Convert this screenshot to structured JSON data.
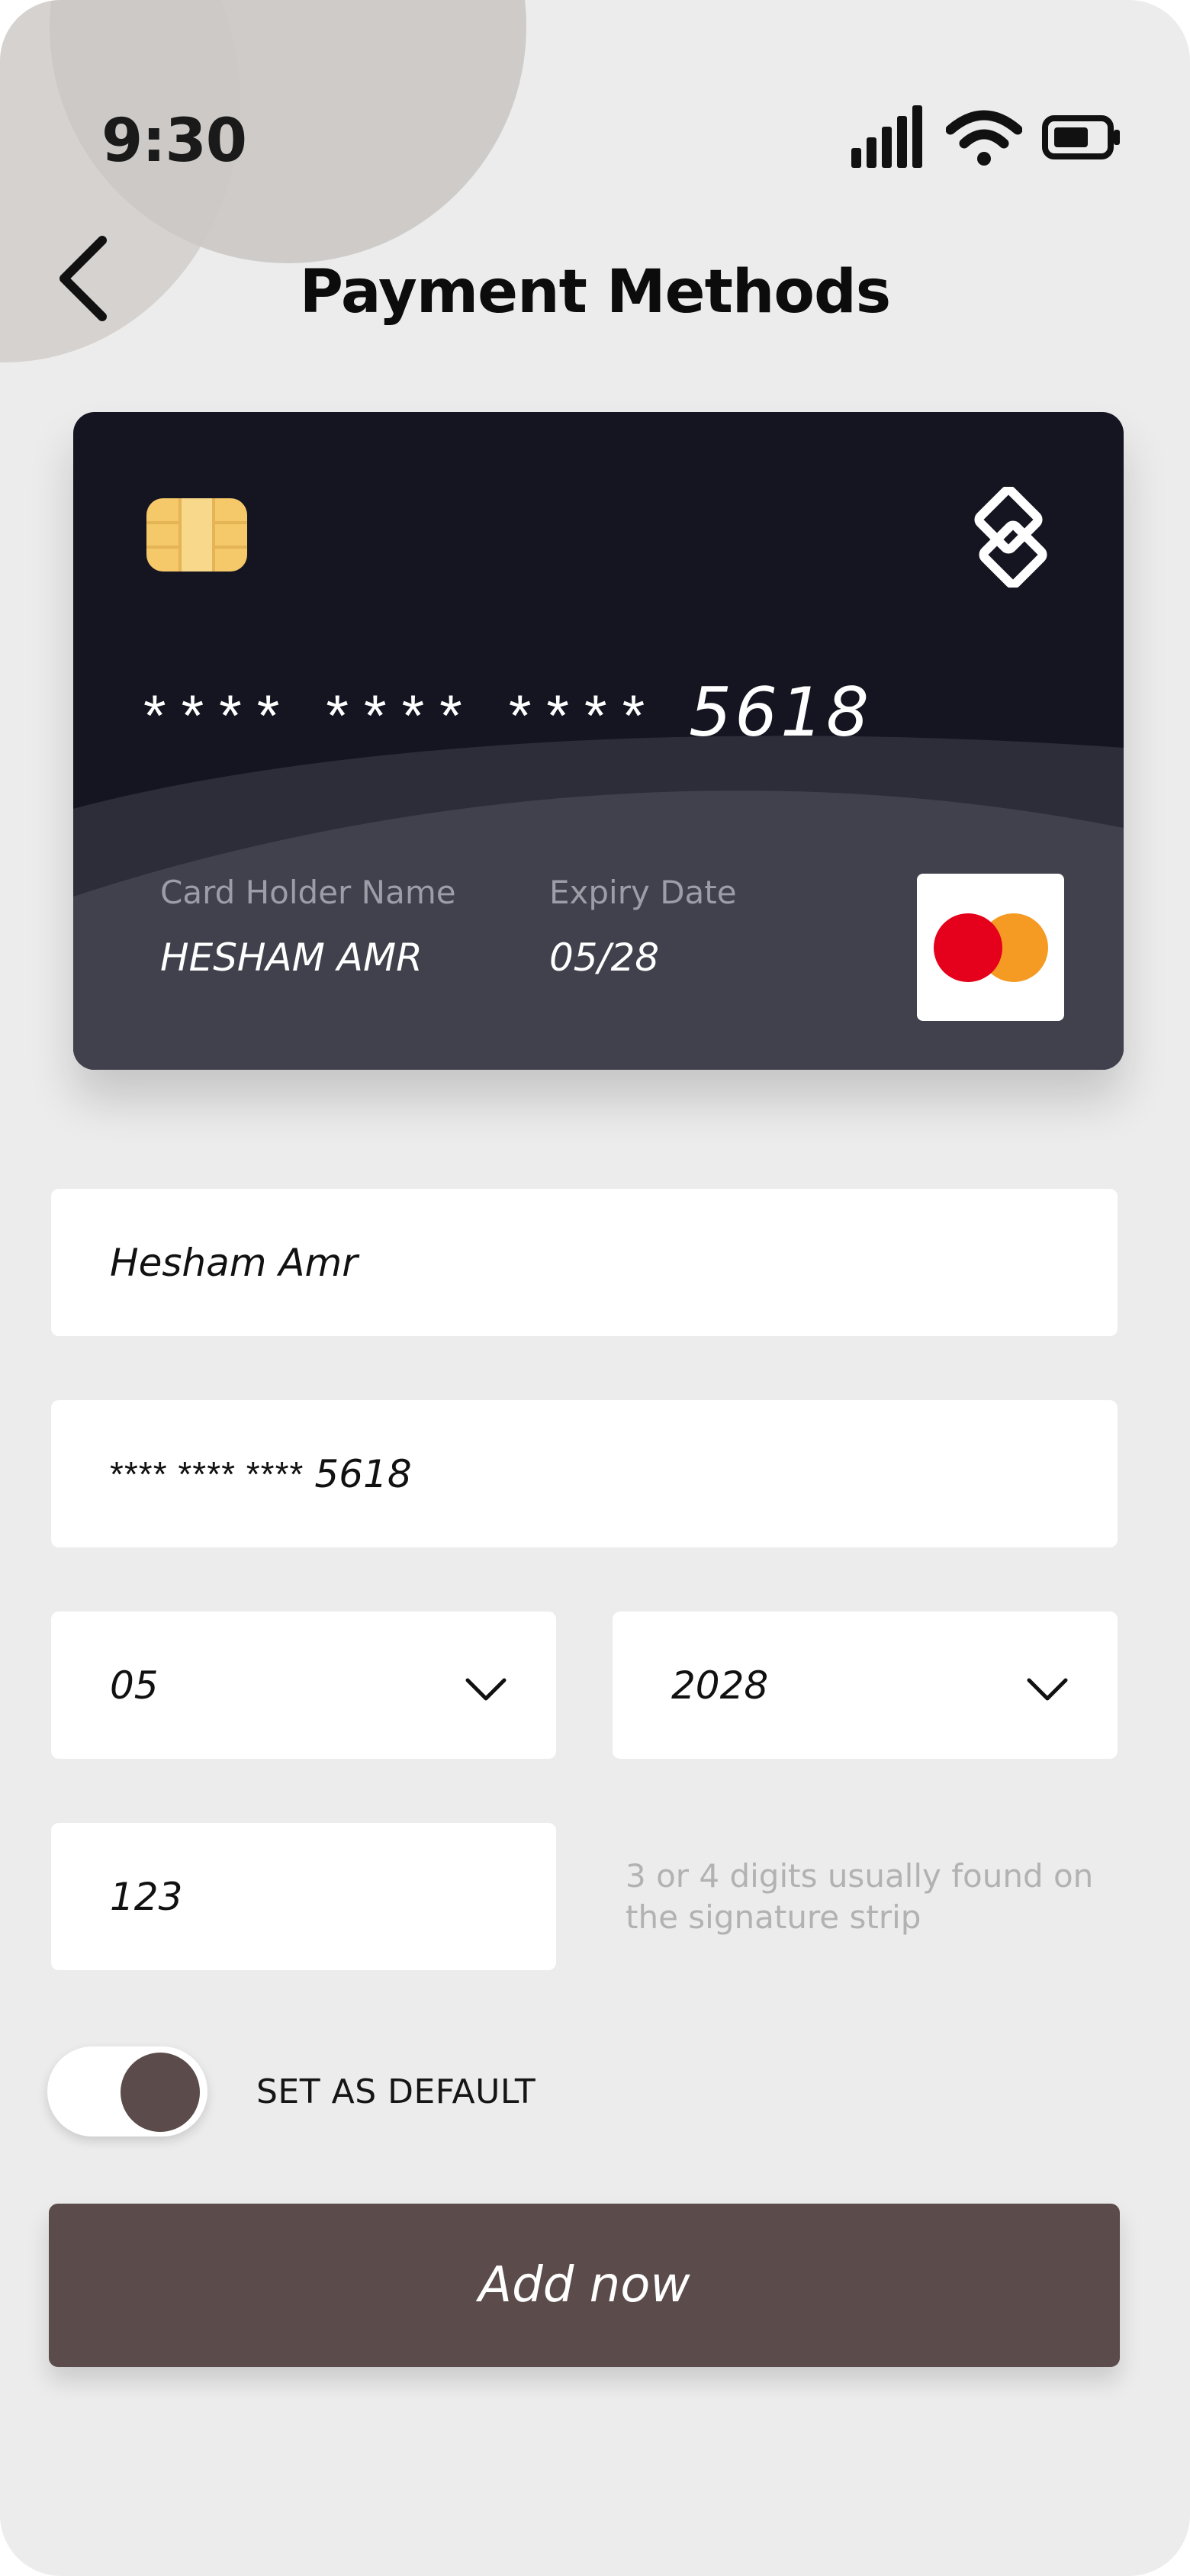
{
  "status_bar": {
    "time": "9:30",
    "icons": [
      "signal-icon",
      "wifi-icon",
      "battery-icon"
    ]
  },
  "header": {
    "title": "Payment Methods",
    "back_icon": "chevron-left-icon"
  },
  "card": {
    "number_mask": "**** **** ****",
    "last4": "5618",
    "holder_label": "Card Holder Name",
    "holder_value": "HESHAM AMR",
    "expiry_label": "Expiry Date",
    "expiry_value": "05/28",
    "brand_logo": "logo-icon",
    "network_logo": "mastercard-icon"
  },
  "form": {
    "name_value": "Hesham Amr",
    "number_mask": "**** **** ****",
    "number_last4": "5618",
    "month_value": "05",
    "year_value": "2028",
    "cvv_value": "123",
    "cvv_hint": "3 or 4 digits usually found on the signature strip"
  },
  "default_toggle": {
    "label": "SET AS DEFAULT",
    "on": true
  },
  "actions": {
    "add_label": "Add now"
  },
  "colors": {
    "background": "#ececec",
    "card": "#151521",
    "card_wave": "#41414d",
    "accent": "#5b4b4b",
    "chip": "#f5c869",
    "mastercard_red": "#e5001c",
    "mastercard_orange": "#f59a23"
  }
}
